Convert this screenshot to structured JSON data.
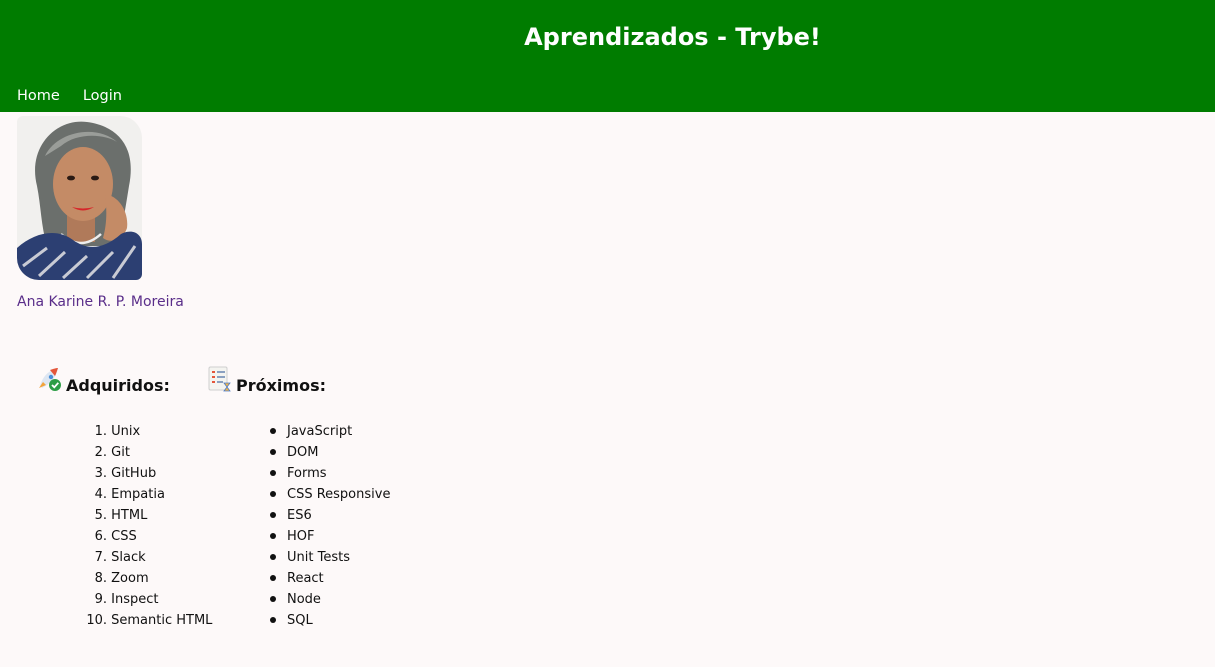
{
  "header": {
    "title": "Aprendizados - Trybe!",
    "background_color": "#007c00"
  },
  "nav": {
    "items": [
      {
        "label": "Home"
      },
      {
        "label": "Login"
      }
    ]
  },
  "profile": {
    "photo_icon": "profile-photo",
    "name": "Ana Karine R. P. Moreira",
    "name_color": "#5a2e8a"
  },
  "acquired": {
    "icon": "rocket-check-icon",
    "heading": "Adquiridos:",
    "items": [
      {
        "num": "1.",
        "label": "Unix"
      },
      {
        "num": "2.",
        "label": "Git"
      },
      {
        "num": "3.",
        "label": "GitHub"
      },
      {
        "num": "4.",
        "label": "Empatia"
      },
      {
        "num": "5.",
        "label": "HTML"
      },
      {
        "num": "6.",
        "label": "CSS"
      },
      {
        "num": "7.",
        "label": "Slack"
      },
      {
        "num": "8.",
        "label": "Zoom"
      },
      {
        "num": "9.",
        "label": "Inspect"
      },
      {
        "num": "10.",
        "label": "Semantic HTML"
      }
    ]
  },
  "next": {
    "icon": "todo-list-icon",
    "heading": "Próximos:",
    "items": [
      {
        "label": "JavaScript"
      },
      {
        "label": "DOM"
      },
      {
        "label": "Forms"
      },
      {
        "label": "CSS Responsive"
      },
      {
        "label": "ES6"
      },
      {
        "label": "HOF"
      },
      {
        "label": "Unit Tests"
      },
      {
        "label": "React"
      },
      {
        "label": "Node"
      },
      {
        "label": "SQL"
      }
    ]
  }
}
